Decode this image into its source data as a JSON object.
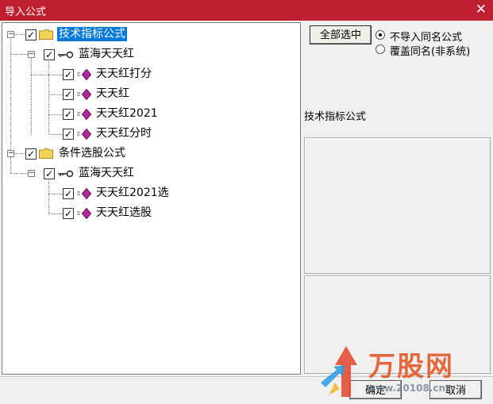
{
  "window": {
    "title": "导入公式",
    "close_glyph": "✕"
  },
  "tree": {
    "expand_glyph": "−",
    "check_glyph": "✓",
    "nodes": [
      {
        "label": "技术指标公式",
        "checked": true,
        "selected": true,
        "icon": "folder-icon"
      },
      {
        "label": "蓝海天天红",
        "checked": true,
        "icon": "key-icon"
      },
      {
        "label": "天天红打分",
        "checked": true,
        "icon": "formula-gem-icon"
      },
      {
        "label": "天天红",
        "checked": true,
        "icon": "formula-gem-icon"
      },
      {
        "label": "天天红2021",
        "checked": true,
        "icon": "formula-gem-icon"
      },
      {
        "label": "天天红分时",
        "checked": true,
        "icon": "formula-gem-icon"
      },
      {
        "label": "条件选股公式",
        "checked": true,
        "icon": "folder-icon"
      },
      {
        "label": "蓝海天天红",
        "checked": true,
        "icon": "key-icon"
      },
      {
        "label": "天天红2021选",
        "checked": true,
        "icon": "formula-gem-icon"
      },
      {
        "label": "天天红选股",
        "checked": true,
        "icon": "formula-gem-icon"
      }
    ]
  },
  "options": {
    "select_all_label": "全部选中",
    "radio_skip_label": "不导入同名公式",
    "radio_overwrite_label": "覆盖同名(非系统)",
    "selected_option": "skip"
  },
  "info": {
    "category_text": "技术指标公式"
  },
  "buttons": {
    "ok_label": "确定",
    "cancel_label": "取消"
  },
  "watermark": {
    "brand": "万股网",
    "url": "www.20108.cn"
  },
  "colors": {
    "title_bar": "#bf1e2e",
    "selection": "#0078d7",
    "gem": "#b0289a",
    "folder": "#f2d25a"
  }
}
